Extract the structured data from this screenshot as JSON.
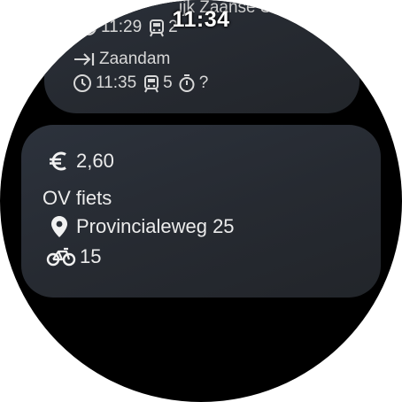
{
  "status_bar": {
    "time": "11:34"
  },
  "previous_leg": {
    "partial_stop_name": "ijk Zaanse Sc",
    "partial_time": "11:29",
    "partial_platform": "2",
    "destination": "Zaandam",
    "time": "11:35",
    "platform": "5",
    "duration": "?"
  },
  "bike_leg": {
    "price": "2,60",
    "title": "OV fiets",
    "location": "Provincialeweg 25",
    "bikes_available": "15"
  },
  "icons": {
    "euro": "euro-icon",
    "pin": "location-pin-icon",
    "bike": "bicycle-icon",
    "clock": "clock-icon",
    "tram": "tram-icon",
    "timer": "timer-icon",
    "arrow": "arrow-to-bar-icon"
  },
  "colors": {
    "background": "#000000",
    "card": "#2a2f37",
    "text": "#ececec"
  }
}
